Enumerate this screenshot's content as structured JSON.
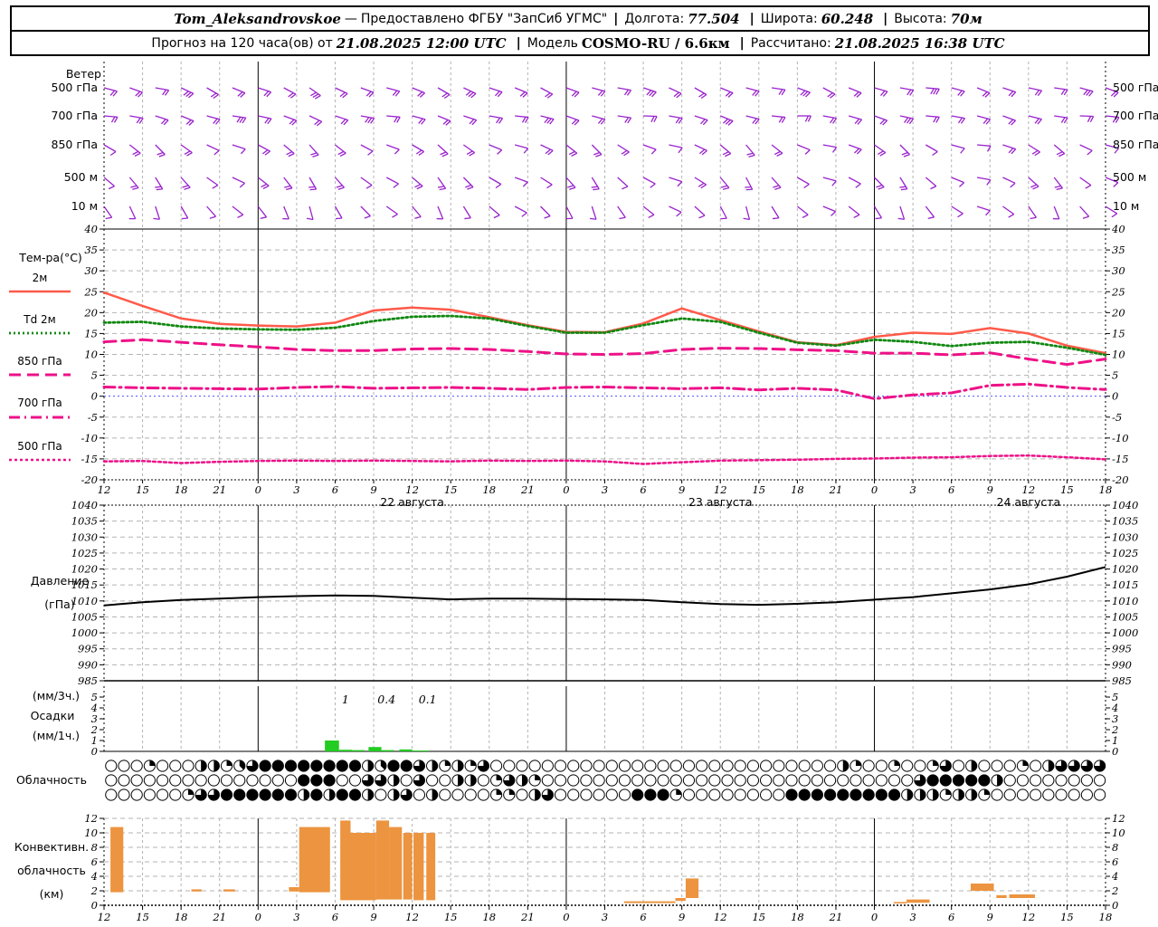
{
  "header": {
    "station": "Tom_Aleksandrovskoe",
    "dash": "—",
    "provider": "Предоставлено ФГБУ \"ЗапСиб УГМС\"",
    "sep": "|",
    "lon_label": "Долгота:",
    "lon": "77.504",
    "lat_label": "Широта:",
    "lat": "60.248",
    "alt_label": "Высота:",
    "alt": "70м",
    "forecast_prefix": "Прогноз на 120 часа(ов) от",
    "forecast_time": "21.08.2025 12:00 UTC",
    "model_label": "Модель",
    "model": "COSMO-RU / 6.6км",
    "calc_label": "Рассчитано:",
    "calc_time": "21.08.2025 16:38 UTC"
  },
  "chart_data": {
    "type": "meteogram",
    "colors": {
      "wind": "#9922CC",
      "t2m": "#FF5A4A",
      "td2m": "#118811",
      "pink": "#EE1188",
      "zero_line": "#5050FF",
      "pressure": "#000000",
      "precip_bar": "#22CC22",
      "conv_bar": "#EC9440",
      "grid": "#B3B3B3"
    },
    "x_axis": {
      "hours_span": 78,
      "step_hours": 3,
      "tick_labels": [
        "12",
        "15",
        "18",
        "21",
        "0",
        "3",
        "6",
        "9",
        "12",
        "15",
        "18",
        "21",
        "0",
        "3",
        "6",
        "9",
        "12",
        "15",
        "18",
        "21",
        "0",
        "3",
        "6",
        "9",
        "12",
        "15",
        "18"
      ],
      "midnight_hours": [
        12,
        36,
        60
      ],
      "day_labels": [
        {
          "label": "22 августа",
          "hour": 24
        },
        {
          "label": "23 августа",
          "hour": 48
        },
        {
          "label": "24 августа",
          "hour": 72
        }
      ]
    },
    "wind": {
      "title": "Ветер",
      "levels": [
        {
          "label": "500 гПа",
          "angles": [
            105,
            110,
            100,
            115,
            120,
            112,
            108,
            118,
            125,
            115,
            110,
            105,
            112,
            120,
            115,
            108,
            112,
            118,
            110,
            105,
            100,
            108,
            115,
            120,
            112,
            105,
            98,
            110,
            118,
            112,
            106,
            100,
            95,
            105,
            112,
            108,
            102,
            98,
            105,
            110
          ],
          "feathers": [
            2,
            2,
            2,
            3,
            2,
            2,
            2,
            2,
            3,
            2,
            2,
            2,
            2,
            2,
            3,
            2,
            2,
            2,
            2,
            2,
            2,
            3,
            2,
            2,
            2,
            2,
            2,
            3,
            2,
            2,
            2,
            2,
            3,
            2,
            2,
            2,
            2,
            2,
            3,
            2
          ]
        },
        {
          "label": "700 гПа",
          "angles": [
            95,
            100,
            108,
            112,
            105,
            98,
            102,
            110,
            115,
            108,
            100,
            95,
            105,
            112,
            108,
            100,
            96,
            104,
            110,
            105,
            98,
            92,
            100,
            108,
            112,
            104,
            96,
            90,
            100,
            106,
            110,
            102,
            95,
            100,
            105,
            110,
            104,
            98,
            92,
            96
          ],
          "feathers": [
            2,
            2,
            2,
            2,
            2,
            3,
            2,
            2,
            2,
            2,
            3,
            2,
            2,
            2,
            2,
            2,
            2,
            3,
            2,
            2,
            2,
            2,
            2,
            2,
            3,
            2,
            2,
            2,
            2,
            2,
            2,
            3,
            2,
            2,
            2,
            2,
            2,
            2,
            2,
            2
          ]
        },
        {
          "label": "850 гПа",
          "angles": [
            120,
            128,
            135,
            125,
            115,
            108,
            118,
            130,
            138,
            128,
            118,
            110,
            120,
            132,
            125,
            112,
            105,
            115,
            128,
            135,
            122,
            110,
            102,
            115,
            130,
            140,
            128,
            112,
            100,
            110,
            125,
            135,
            120,
            105,
            95,
            108,
            122,
            130,
            115,
            105
          ],
          "feathers": [
            1,
            2,
            2,
            2,
            1,
            1,
            2,
            2,
            2,
            2,
            1,
            1,
            2,
            2,
            2,
            1,
            1,
            2,
            2,
            2,
            2,
            1,
            1,
            2,
            2,
            2,
            2,
            1,
            1,
            2,
            2,
            2,
            1,
            1,
            1,
            2,
            2,
            2,
            1,
            1
          ]
        },
        {
          "label": "500 м",
          "angles": [
            130,
            140,
            148,
            138,
            125,
            115,
            128,
            142,
            150,
            138,
            125,
            118,
            130,
            145,
            135,
            120,
            110,
            122,
            138,
            148,
            132,
            118,
            108,
            122,
            140,
            152,
            138,
            120,
            105,
            118,
            135,
            148,
            130,
            112,
            100,
            115,
            132,
            142,
            125,
            112
          ],
          "feathers": [
            1,
            2,
            2,
            2,
            1,
            1,
            2,
            2,
            2,
            2,
            1,
            1,
            2,
            2,
            2,
            1,
            1,
            1,
            2,
            2,
            1,
            1,
            1,
            2,
            2,
            2,
            2,
            1,
            1,
            1,
            2,
            2,
            1,
            1,
            1,
            1,
            2,
            2,
            1,
            1
          ]
        },
        {
          "label": "10 м",
          "angles": [
            145,
            155,
            162,
            150,
            138,
            128,
            142,
            158,
            165,
            150,
            135,
            125,
            140,
            158,
            148,
            130,
            118,
            135,
            152,
            162,
            145,
            128,
            115,
            132,
            152,
            165,
            148,
            128,
            112,
            128,
            148,
            162,
            142,
            122,
            108,
            125,
            145,
            158,
            138,
            122
          ],
          "feathers": [
            1,
            1,
            1,
            1,
            1,
            1,
            1,
            1,
            1,
            1,
            1,
            1,
            1,
            1,
            1,
            1,
            1,
            1,
            1,
            1,
            1,
            1,
            1,
            1,
            1,
            1,
            1,
            1,
            1,
            1,
            1,
            1,
            1,
            1,
            1,
            1,
            1,
            1,
            1,
            1
          ]
        }
      ]
    },
    "temperature": {
      "title": "Тем-ра(°C)",
      "ylim": [
        -20,
        40
      ],
      "tick_labels": [
        "40",
        "35",
        "30",
        "25",
        "20",
        "15",
        "10",
        "5",
        "0",
        "-5",
        "-10",
        "-15",
        "-20"
      ],
      "series": [
        {
          "id": "t2m",
          "label": "2м",
          "color": "#FF5A4A",
          "values": [
            24.8,
            21.6,
            18.6,
            17.3,
            16.9,
            16.7,
            17.6,
            20.5,
            21.2,
            20.7,
            18.9,
            17.0,
            15.4,
            15.3,
            17.4,
            21.0,
            18.2,
            15.5,
            12.9,
            12.2,
            14.2,
            15.2,
            14.9,
            16.3,
            15.0,
            12.1,
            10.3
          ]
        },
        {
          "id": "td2m",
          "label": "Td  2м",
          "color": "#118811",
          "values": [
            17.6,
            17.8,
            16.7,
            16.2,
            16.0,
            15.9,
            16.4,
            18.0,
            19.0,
            19.2,
            18.6,
            16.8,
            15.2,
            15.2,
            17.0,
            18.6,
            17.8,
            15.2,
            12.8,
            12.1,
            13.5,
            13.0,
            12.0,
            12.8,
            13.0,
            11.6,
            9.9
          ]
        },
        {
          "id": "t850",
          "label": "850 гПа",
          "color": "#EE1188",
          "values": [
            13.0,
            13.5,
            12.9,
            12.3,
            11.8,
            11.2,
            10.9,
            10.9,
            11.3,
            11.4,
            11.2,
            10.7,
            10.1,
            10.0,
            10.2,
            11.2,
            11.5,
            11.4,
            11.1,
            10.9,
            10.3,
            10.3,
            9.9,
            10.4,
            8.9,
            7.6,
            8.9
          ]
        },
        {
          "id": "t700",
          "label": "700 гПа",
          "color": "#EE1188",
          "values": [
            2.2,
            2.0,
            1.9,
            1.8,
            1.7,
            2.1,
            2.3,
            1.9,
            2.0,
            2.1,
            1.9,
            1.6,
            2.1,
            2.2,
            2.0,
            1.8,
            2.0,
            1.5,
            1.9,
            1.5,
            -0.6,
            0.3,
            0.8,
            2.6,
            2.9,
            2.1,
            1.6
          ]
        },
        {
          "id": "t500",
          "label": "500 гПа",
          "color": "#EE1188",
          "values": [
            -15.6,
            -15.5,
            -16.0,
            -15.7,
            -15.5,
            -15.4,
            -15.5,
            -15.4,
            -15.5,
            -15.6,
            -15.4,
            -15.5,
            -15.4,
            -15.6,
            -16.2,
            -15.8,
            -15.4,
            -15.3,
            -15.2,
            -15.0,
            -14.9,
            -14.7,
            -14.6,
            -14.3,
            -14.2,
            -14.6,
            -15.1
          ]
        }
      ]
    },
    "pressure": {
      "label1": "Давление",
      "label2": "(гПа)",
      "ylim": [
        985,
        1040
      ],
      "tick_labels": [
        "1040",
        "1035",
        "1030",
        "1025",
        "1020",
        "1015",
        "1010",
        "1005",
        "1000",
        "995",
        "990",
        "985"
      ],
      "values": [
        1008.6,
        1009.6,
        1010.3,
        1010.7,
        1011.2,
        1011.5,
        1011.7,
        1011.6,
        1011.0,
        1010.5,
        1010.7,
        1010.7,
        1010.6,
        1010.5,
        1010.3,
        1009.6,
        1009.0,
        1008.8,
        1009.1,
        1009.6,
        1010.4,
        1011.2,
        1012.4,
        1013.6,
        1015.2,
        1017.6,
        1020.6
      ]
    },
    "precip": {
      "labels": [
        "(мм/3ч.)",
        "Осадки",
        "(мм/1ч.)"
      ],
      "ylim": [
        0,
        6
      ],
      "tick_labels": [
        "5",
        "4",
        "3",
        "2",
        "1",
        "0"
      ],
      "tick_values": [
        5,
        4,
        3,
        2,
        1,
        0
      ],
      "bars": [
        {
          "h0": 17.2,
          "h1": 18.3,
          "v": 1.0
        },
        {
          "h0": 18.3,
          "h1": 19.3,
          "v": 0.15
        },
        {
          "h0": 19.3,
          "h1": 20.3,
          "v": 0.12
        },
        {
          "h0": 20.6,
          "h1": 21.6,
          "v": 0.4
        },
        {
          "h0": 21.6,
          "h1": 22.6,
          "v": 0.12
        },
        {
          "h0": 23.0,
          "h1": 24.0,
          "v": 0.18
        },
        {
          "h0": 24.0,
          "h1": 25.3,
          "v": 0.08
        }
      ],
      "annotations": [
        {
          "text": "1",
          "hour": 18.8
        },
        {
          "text": "0.4",
          "hour": 22.0
        },
        {
          "text": "0.1",
          "hour": 25.2
        }
      ]
    },
    "cloud": {
      "label": "Облачность",
      "rows_eighths": [
        [
          0,
          0,
          0,
          2,
          0,
          0,
          0,
          4,
          4,
          2,
          3,
          6,
          8,
          8,
          8,
          8,
          8,
          8,
          8,
          8,
          4,
          3,
          8,
          8,
          6,
          4,
          2,
          4,
          2,
          6,
          0,
          0,
          0,
          0,
          0,
          0,
          0,
          0,
          0,
          0,
          0,
          0,
          0,
          0,
          0,
          0,
          0,
          0,
          0,
          0,
          0,
          0,
          0,
          0,
          0,
          0,
          0,
          4,
          2,
          0,
          0,
          2,
          0,
          0,
          2,
          6,
          0,
          4,
          0,
          0,
          0,
          2,
          0,
          4,
          6,
          6,
          6,
          6
        ],
        [
          0,
          0,
          0,
          0,
          0,
          0,
          0,
          0,
          0,
          0,
          0,
          0,
          0,
          0,
          0,
          8,
          8,
          8,
          0,
          0,
          6,
          6,
          4,
          0,
          6,
          0,
          0,
          4,
          4,
          0,
          2,
          6,
          4,
          2,
          0,
          0,
          0,
          0,
          0,
          0,
          0,
          0,
          0,
          0,
          0,
          0,
          0,
          0,
          0,
          0,
          0,
          0,
          0,
          0,
          0,
          0,
          0,
          0,
          0,
          0,
          0,
          0,
          0,
          6,
          8,
          8,
          8,
          8,
          8,
          4,
          0,
          0,
          0,
          0,
          0,
          0,
          0,
          0
        ],
        [
          0,
          0,
          0,
          0,
          0,
          0,
          2,
          6,
          6,
          8,
          8,
          8,
          8,
          8,
          8,
          4,
          8,
          4,
          8,
          8,
          4,
          0,
          4,
          6,
          0,
          4,
          0,
          0,
          0,
          0,
          2,
          2,
          0,
          4,
          6,
          0,
          0,
          0,
          0,
          0,
          0,
          8,
          8,
          8,
          2,
          0,
          0,
          0,
          0,
          0,
          0,
          0,
          0,
          8,
          8,
          8,
          8,
          8,
          8,
          8,
          8,
          8,
          4,
          4,
          4,
          2,
          4,
          4,
          2,
          0,
          0,
          0,
          0,
          0,
          0,
          0,
          0,
          0
        ]
      ]
    },
    "convective": {
      "labels": [
        "Конвективн.",
        "облачность",
        "(км)"
      ],
      "ylim": [
        0,
        12
      ],
      "tick_labels": [
        "12",
        "10",
        "8",
        "6",
        "4",
        "2",
        "0"
      ],
      "tick_values": [
        12,
        10,
        8,
        6,
        4,
        2,
        0
      ],
      "bars": [
        {
          "h0": 0.5,
          "h1": 1.5,
          "base": 1.8,
          "top": 10.8
        },
        {
          "h0": 6.8,
          "h1": 7.6,
          "base": 1.9,
          "top": 2.2
        },
        {
          "h0": 9.3,
          "h1": 10.2,
          "base": 1.9,
          "top": 2.2
        },
        {
          "h0": 14.4,
          "h1": 15.2,
          "base": 1.9,
          "top": 2.5
        },
        {
          "h0": 15.2,
          "h1": 17.6,
          "base": 1.8,
          "top": 10.8
        },
        {
          "h0": 18.4,
          "h1": 19.2,
          "base": 0.7,
          "top": 11.7
        },
        {
          "h0": 19.2,
          "h1": 21.2,
          "base": 0.7,
          "top": 10.0
        },
        {
          "h0": 21.2,
          "h1": 22.2,
          "base": 0.8,
          "top": 11.7
        },
        {
          "h0": 22.2,
          "h1": 23.2,
          "base": 0.8,
          "top": 10.8
        },
        {
          "h0": 23.3,
          "h1": 24.0,
          "base": 0.8,
          "top": 10.0
        },
        {
          "h0": 24.1,
          "h1": 24.9,
          "base": 0.7,
          "top": 10.0
        },
        {
          "h0": 25.1,
          "h1": 25.8,
          "base": 0.7,
          "top": 10.0
        },
        {
          "h0": 40.5,
          "h1": 44.5,
          "base": 0.3,
          "top": 0.55
        },
        {
          "h0": 44.5,
          "h1": 45.3,
          "base": 0.6,
          "top": 1.0
        },
        {
          "h0": 45.3,
          "h1": 46.3,
          "base": 1.0,
          "top": 3.7
        },
        {
          "h0": 61.5,
          "h1": 62.5,
          "base": 0.25,
          "top": 0.45
        },
        {
          "h0": 62.5,
          "h1": 64.3,
          "base": 0.35,
          "top": 0.8
        },
        {
          "h0": 67.5,
          "h1": 69.3,
          "base": 2.0,
          "top": 3.0
        },
        {
          "h0": 69.5,
          "h1": 70.3,
          "base": 1.0,
          "top": 1.4
        },
        {
          "h0": 70.5,
          "h1": 72.5,
          "base": 1.0,
          "top": 1.5
        }
      ]
    }
  }
}
